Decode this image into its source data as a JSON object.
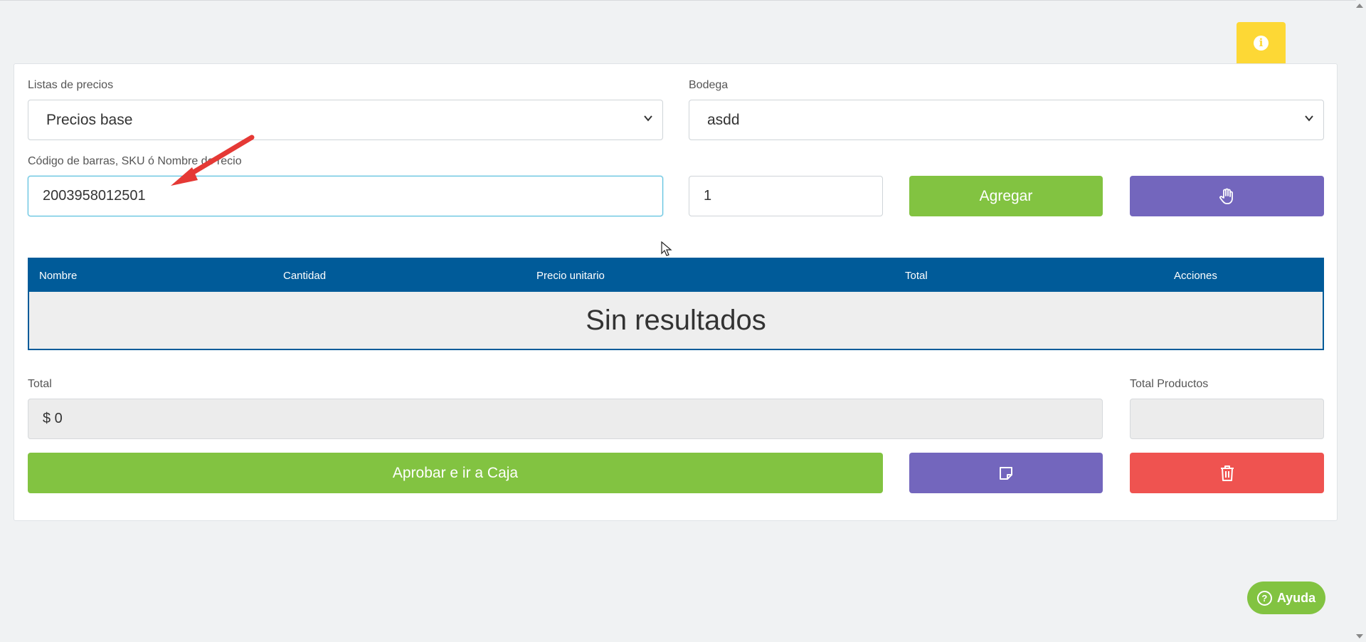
{
  "form": {
    "price_list_label": "Listas de precios",
    "price_list_value": "Precios base",
    "warehouse_label": "Bodega",
    "warehouse_value": "asdd",
    "search_label": "Código de barras, SKU ó Nombre de recio",
    "search_value": "2003958012501",
    "quantity_value": "1",
    "add_button_label": "Agregar"
  },
  "table": {
    "columns": [
      "Nombre",
      "Cantidad",
      "Precio unitario",
      "Total",
      "Acciones"
    ],
    "empty_message": "Sin resultados"
  },
  "summary": {
    "total_label": "Total",
    "total_value": "$ 0",
    "total_products_label": "Total Productos",
    "total_products_value": ""
  },
  "actions": {
    "approve_label": "Aprobar e ir a Caja"
  },
  "help": {
    "label": "Ayuda"
  },
  "icons": {
    "info": "info-icon",
    "hand": "hand-icon",
    "note": "sticky-note-icon",
    "trash": "trash-icon",
    "help": "question-circle-icon"
  },
  "colors": {
    "green": "#82c341",
    "purple": "#7366bd",
    "red": "#ef5350",
    "table_header": "#005b99",
    "info_tab": "#fdd835"
  }
}
